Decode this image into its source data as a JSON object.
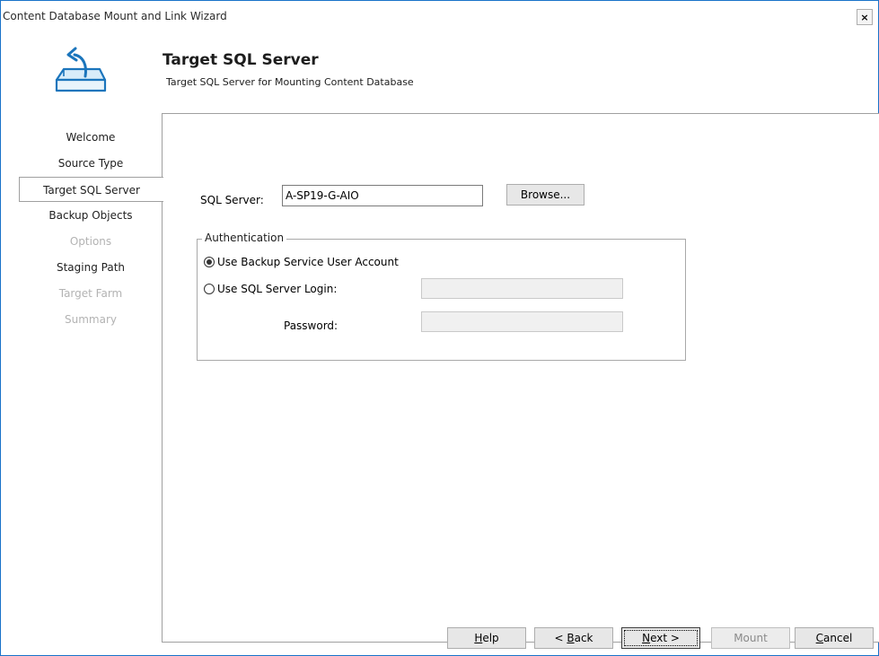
{
  "window": {
    "title": "Content Database Mount and Link Wizard",
    "close_label": "×"
  },
  "header": {
    "title": "Target SQL Server",
    "subtitle": "Target SQL Server for Mounting Content Database",
    "logo_icon": "database-mount-icon"
  },
  "nav": {
    "items": [
      {
        "label": "Welcome",
        "state": "normal"
      },
      {
        "label": "Source Type",
        "state": "normal"
      },
      {
        "label": "Target SQL Server",
        "state": "active"
      },
      {
        "label": "Backup Objects",
        "state": "normal"
      },
      {
        "label": "Options",
        "state": "disabled"
      },
      {
        "label": "Staging Path",
        "state": "normal"
      },
      {
        "label": "Target Farm",
        "state": "disabled"
      },
      {
        "label": "Summary",
        "state": "disabled"
      }
    ]
  },
  "form": {
    "sql_server_label": "SQL Server:",
    "sql_server_value": "A-SP19-G-AIO",
    "browse_label": "Browse...",
    "auth_group_label": "Authentication",
    "radio_backup_account": "Use Backup Service User Account",
    "radio_sql_login": "Use SQL Server Login:",
    "password_label": "Password:",
    "selected_auth": "backup_account"
  },
  "footer": {
    "help": {
      "pre": "",
      "key": "H",
      "post": "elp"
    },
    "back": {
      "pre": "< ",
      "key": "B",
      "post": "ack"
    },
    "next": {
      "pre": "",
      "key": "N",
      "post": "ext >"
    },
    "mount": "Mount",
    "cancel": {
      "pre": "",
      "key": "C",
      "post": "ancel"
    }
  },
  "colors": {
    "window_border": "#1a73c9",
    "icon_blue": "#1b75bc",
    "disabled_text": "#b3b3b3"
  }
}
